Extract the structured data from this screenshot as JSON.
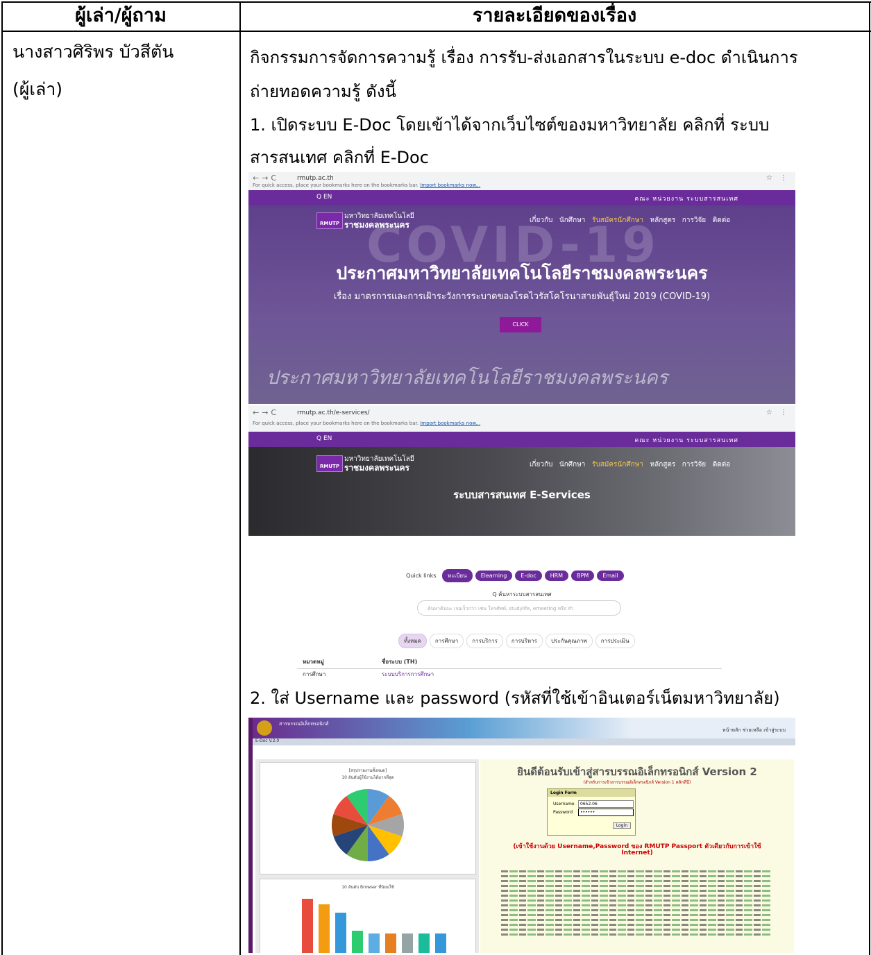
{
  "table": {
    "col1_header": "ผู้เล่า/ผู้ถาม",
    "col2_header": "รายละเอียดของเรื่อง",
    "narrator_name": "นางสาวศิริพร บัวสีตัน",
    "narrator_role": "(ผู้เล่า)",
    "paragraph_line1": "กิจกรรมการจัดการความรู้ เรื่อง การรับ-ส่งเอกสารในระบบ e-doc ดำเนินการ",
    "paragraph_line2": "ถ่ายทอดความรู้ ดังนี้",
    "step1_line1": "1. เปิดระบบ E-Doc โดยเข้าได้จากเว็บไซต์ของมหาวิทยาลัย คลิกที่ ระบบ",
    "step1_line2": "สารสนเทศ คลิกที่ E-Doc",
    "step2": "2. ใส่ Username และ password (รหัสที่ใช้เข้าอินเตอร์เน็ตมหาวิทยาลัย)"
  },
  "screenshot1": {
    "url": "rmutp.ac.th",
    "bookmarks_text": "For quick access, place your bookmarks here on the bookmarks bar.",
    "bookmarks_link": "Import bookmarks now...",
    "search_lang": "Q EN",
    "top_links": "คณะ  หน่วยงาน  ระบบสารสนเทศ",
    "logo_line1": "มหาวิทยาลัยเทคโนโลยี",
    "logo_line2": "ราชมงคลพระนคร",
    "logo_badge": "RMUTP",
    "nav_items": [
      "เกี่ยวกับ",
      "นักศึกษา",
      "รับสมัครนักศึกษา",
      "หลักสูตร",
      "การวิจัย",
      "ติดต่อ"
    ],
    "covid_bg": "COVID-19",
    "headline": "ประกาศมหาวิทยาลัยเทคโนโลยีราชมงคลพระนคร",
    "subline": "เรื่อง มาตรการและการเฝ้าระวังการระบาดของโรคไวรัสโคโรนาสายพันธุ์ใหม่ 2019 (COVID-19)",
    "button": "CLICK",
    "bottom_headline": "ประกาศมหาวิทยาลัยเทคโนโลยีราชมงคลพระนคร"
  },
  "screenshot2": {
    "url": "rmutp.ac.th/e-services/",
    "hero_title": "ระบบสารสนเทศ E-Services",
    "quick_links_label": "Quick links",
    "quick_links": [
      "ทะเบียน",
      "Elearning",
      "E-doc",
      "HRM",
      "BPM",
      "Email"
    ],
    "search_label": "Q ค้นหาระบบสารสนเทศ",
    "search_placeholder": "ค้นหาค้นบะ เจอเร็วกว่า เช่น โทรศัพท์, studylife, emeeting หรือ สำ",
    "filter_tabs": [
      "ทั้งหมด",
      "การศึกษา",
      "การบริการ",
      "การบริหาร",
      "ประกันคุณภาพ",
      "การประเมิน"
    ],
    "col_category": "หมวดหมู่",
    "col_system": "ชื่อระบบ (TH)",
    "row_category": "การศึกษา",
    "row_system": "ระบบบริการการศึกษา"
  },
  "screenshot3": {
    "header_title": "สารบรรณอิเล็กทรอนิกส์",
    "header_links": "หน้าหลัก  ช่วยเหลือ  เข้าสู่ระบบ",
    "version_tab": "E-Doc V.2.0",
    "welcome": "ยินดีต้อนรับเข้าสู่สารบรรณอิเล็กทรอนิกส์ Version 2",
    "welcome_sub": "(สำหรับการเข้าสารบรรณอิเล็กทรอนิกส์ Version 1 คลิกที่นี่)",
    "login_form_title": "Login Form",
    "username_label": "Username",
    "username_value": "0652.06",
    "password_label": "Password",
    "password_value": "••••••",
    "login_button": "Login",
    "red_line1": "(เข้าใช้งานด้วย Username,Password ของ RMUTP Passport ตัวเดียวกับการเข้าใช้",
    "red_line2": "Internet)",
    "chart1_title": "10 อันดับผู้ใช้งานได้มากที่สุด",
    "chart2_title": "10 อันดับ Browser ที่นิยมใช้",
    "left_header": "[สรุปรายงานทั้งหมด]",
    "colors": {
      "pie": [
        "#5b9bd5",
        "#ed7d31",
        "#a5a5a5",
        "#ffc000",
        "#4472c4",
        "#70ad47",
        "#264478",
        "#9e480e",
        "#e74c3c",
        "#2ecc71"
      ],
      "bars": [
        "#e74c3c",
        "#f39c12",
        "#3498db",
        "#2ecc71",
        "#5dade2",
        "#e67e22",
        "#95a5a6",
        "#1abc9c",
        "#3498db"
      ]
    }
  }
}
